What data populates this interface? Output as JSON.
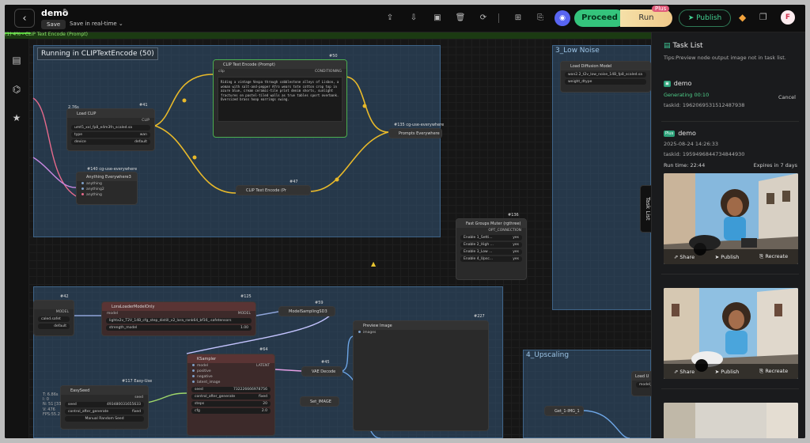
{
  "header": {
    "title": "demo",
    "save_label": "Save",
    "realtime_label": "Save in real-time",
    "proceed_label": "Proceed",
    "run_label": "Run",
    "plus_badge": "Plus",
    "publish_label": "Publish",
    "avatar_initial": "F"
  },
  "progress": {
    "text": "(1) 4% - CLIP Text Encode (Prompt)",
    "percent": 4
  },
  "canvas": {
    "running_label": "Running in CLIPTextEncode (50)",
    "groups": {
      "low_noise": "3_Low Noise",
      "upscaling": "4_Upscaling"
    },
    "clip_encode_top": {
      "id": "#50",
      "title": "CLIP Text Encode (Prompt)",
      "input": "clip",
      "output": "CONDITIONING",
      "text": "Riding a vintage Vespa through cobblestone alleys of Lisbon, a woman with salt-and-pepper Afro wears tote cotton crop top in azure blue, cream ceramic-tile print denim shorts, sunlight fractures on pastel-tiled walls as true tables sport overbank. Oversized brass hoop earrings swing."
    },
    "load_clip": {
      "id": "#41",
      "title": "Load CLIP",
      "time": "2.76s",
      "output": "CLIP",
      "rows": [
        [
          "umt5_xxl_fp8_e4m3fn_scaled.sa",
          ""
        ],
        [
          "type",
          "wan"
        ],
        [
          "device",
          "default"
        ]
      ]
    },
    "anything": {
      "id": "#140",
      "tag": "cg-use-everywhere",
      "title": "Anything Everywhere3",
      "inputs": [
        "anything",
        "anything2",
        "anything"
      ]
    },
    "clip_encode_bottom": {
      "id": "#47",
      "title": "CLIP Text Encode (Pr"
    },
    "prompts_everywhere": {
      "id": "#135",
      "tag": "cg-use-everywhere",
      "title": "Prompts Everywhere"
    },
    "load_diffusion": {
      "title": "Load Diffusion Model",
      "rows": [
        [
          "wan2.2_t2v_low_noise_14B_fp8_scaled.sa",
          ""
        ],
        [
          "weight_dtype",
          ""
        ]
      ]
    },
    "fast_groups": {
      "id": "#136",
      "title": "Fast Groups Muter (rgthree)",
      "output": "OPT_CONNECTION",
      "rows": [
        [
          "Enable 1_Setti...",
          "yes"
        ],
        [
          "Enable 2_High ...",
          "yes"
        ],
        [
          "Enable 3_Low ...",
          "yes"
        ],
        [
          "Enable 4_Upsc...",
          "yes"
        ]
      ]
    },
    "lora": {
      "id": "#125",
      "title": "LoraLoaderModelOnly",
      "input": "model",
      "output": "MODEL",
      "rows": [
        [
          "lora_name",
          "lightx2v_T2V_14B_cfg_step_distill_v2_lora_rank64_bf16_.safetensors"
        ],
        [
          "strength_model",
          "1.00"
        ]
      ]
    },
    "left_node": {
      "id": "#42",
      "output": "MODEL",
      "rows": [
        [
          "caled.safet",
          ""
        ],
        [
          "",
          "default"
        ]
      ]
    },
    "model_sampling": {
      "id": "#59",
      "title": "ModelSamplingSD3"
    },
    "preview": {
      "id": "#227",
      "title": "Preview Image",
      "input": "images"
    },
    "ksampler": {
      "id": "#64",
      "title": "KSampler",
      "inputs": [
        "model",
        "positive",
        "negative",
        "latent_image"
      ],
      "output": "LATENT",
      "rows": [
        [
          "seed",
          "732226666978756"
        ],
        [
          "control_after_generate",
          "fixed"
        ],
        [
          "steps",
          "20"
        ],
        [
          "cfg",
          "2.0"
        ]
      ]
    },
    "vae": {
      "id": "#45",
      "title": "VAE Decode"
    },
    "set_image": {
      "title": "Set_IMAGE"
    },
    "easyseed": {
      "id": "#117",
      "tag": "Easy-Use",
      "title": "EasySeed",
      "output": "seed",
      "rows": [
        [
          "seed",
          "493480031655633"
        ],
        [
          "control_after_generate",
          "fixed"
        ]
      ],
      "button": "Manual Random Seed"
    },
    "get_img": {
      "title": "Get_1-IMG_1"
    },
    "load_up": {
      "title": "Load U",
      "row": "model_"
    },
    "stats": [
      "T: 6.86s",
      "I: 0",
      "N: 51 [33",
      "V: 476",
      "FPS:55.2"
    ]
  },
  "task_list": {
    "title": "Task List",
    "tip": "Tips:Preview node output image not in task list.",
    "tab_label": "Task List",
    "current": {
      "name": "demo",
      "status": "Generating 00:10",
      "taskid": "taskid: 1962069531512487938",
      "cancel": "Cancel"
    },
    "done": {
      "badge": "Plus",
      "name": "demo",
      "date": "2025-08-24 14:26:33",
      "taskid": "taskid: 1959496844734844930",
      "runtime": "Run time: 22:44",
      "expires": "Expires in 7 days"
    },
    "actions": {
      "share": "Share",
      "publish": "Publish",
      "recreate": "Recreate"
    }
  },
  "colors": {
    "accent": "#34c47c",
    "run": "#f0c98a",
    "group": "#345676",
    "wire_yellow": "#e8b92a",
    "wire_pink": "#e86a8c",
    "wire_blue": "#6ea6e6"
  }
}
